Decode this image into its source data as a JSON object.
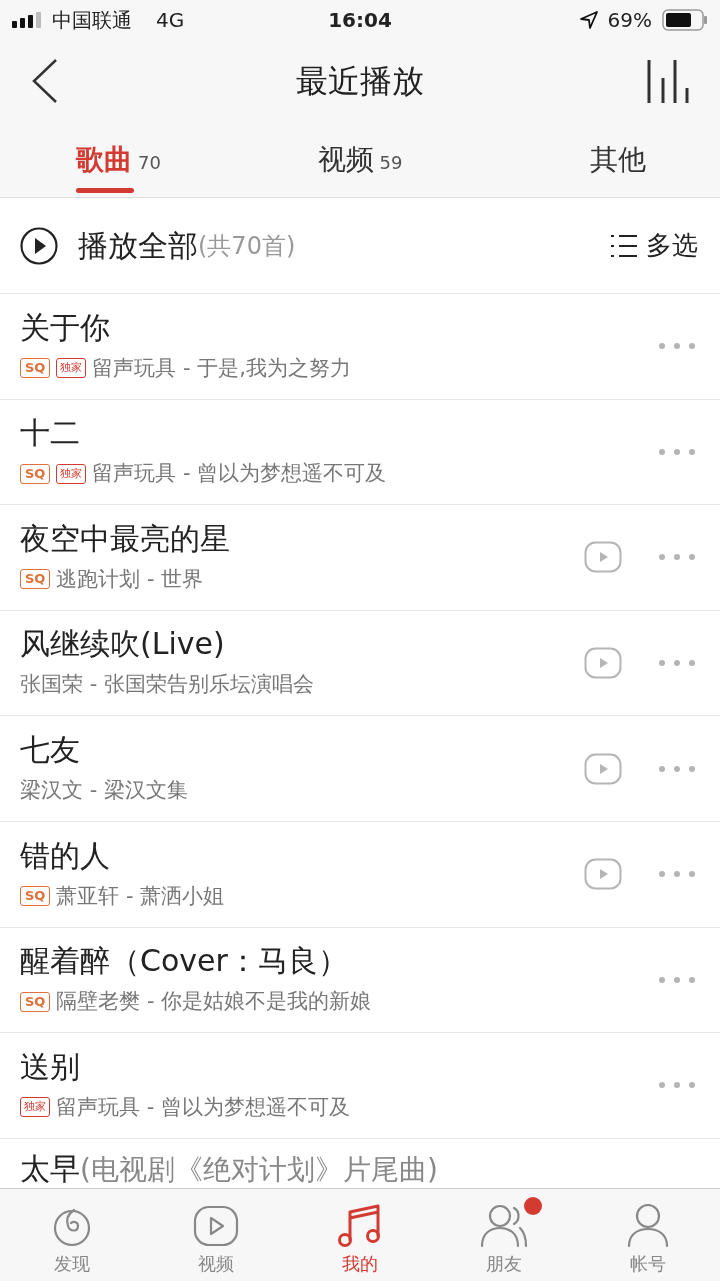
{
  "status_bar": {
    "carrier": "中国联通",
    "network": "4G",
    "time": "16:04",
    "battery": "69%"
  },
  "header": {
    "title": "最近播放"
  },
  "tabs": [
    {
      "label": "歌曲",
      "count": "70",
      "selected": true
    },
    {
      "label": "视频",
      "count": "59",
      "selected": false
    },
    {
      "label": "其他",
      "selected": false
    }
  ],
  "play_all": {
    "label": "播放全部",
    "count": "(共70首)",
    "multi_select": "多选"
  },
  "songs": [
    {
      "title": "关于你",
      "tags": [
        {
          "kind": "sq",
          "label": "SQ"
        },
        {
          "kind": "exclusive",
          "label": "独家"
        }
      ],
      "subtitle": "留声玩具 - 于是,我为之努力",
      "has_mv": false
    },
    {
      "title": "十二",
      "tags": [
        {
          "kind": "sq",
          "label": "SQ"
        },
        {
          "kind": "exclusive",
          "label": "独家"
        }
      ],
      "subtitle": "留声玩具 - 曾以为梦想遥不可及",
      "has_mv": false
    },
    {
      "title": "夜空中最亮的星",
      "tags": [
        {
          "kind": "sq",
          "label": "SQ"
        }
      ],
      "subtitle": "逃跑计划 - 世界",
      "has_mv": true
    },
    {
      "title": "风继续吹(Live)",
      "subtitle": "张国荣 - 张国荣告别乐坛演唱会",
      "has_mv": true
    },
    {
      "title": "七友",
      "subtitle": "梁汉文 - 梁汉文集",
      "has_mv": true
    },
    {
      "title": "错的人",
      "tags": [
        {
          "kind": "sq",
          "label": "SQ"
        }
      ],
      "subtitle": "萧亚轩 - 萧洒小姐",
      "has_mv": true
    },
    {
      "title": "醒着醉（Cover：马良）",
      "tags": [
        {
          "kind": "sq",
          "label": "SQ"
        }
      ],
      "subtitle": "隔壁老樊 - 你是姑娘不是我的新娘",
      "has_mv": false
    },
    {
      "title": "送别",
      "tags": [
        {
          "kind": "exclusive",
          "label": "独家"
        }
      ],
      "subtitle": "留声玩具 - 曾以为梦想遥不可及",
      "has_mv": false
    }
  ],
  "partial_song": {
    "title": "太早",
    "note": "(电视剧《绝对计划》片尾曲)"
  },
  "bottom_nav": [
    {
      "kind": "discover",
      "label": "发现",
      "selected": false,
      "badge": false
    },
    {
      "kind": "video",
      "label": "视频",
      "selected": false,
      "badge": false
    },
    {
      "kind": "music",
      "label": "我的",
      "selected": true,
      "badge": false
    },
    {
      "kind": "friends",
      "label": "朋友",
      "selected": false,
      "badge": true
    },
    {
      "kind": "account",
      "label": "帐号",
      "selected": false,
      "badge": false
    }
  ]
}
